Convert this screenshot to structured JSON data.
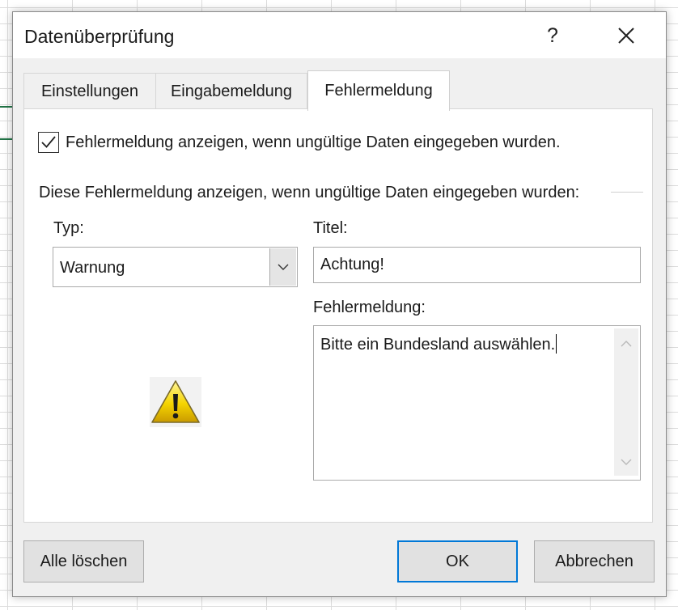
{
  "dialog": {
    "title": "Datenüberprüfung",
    "help_label": "?"
  },
  "tabs": [
    {
      "label": "Einstellungen",
      "active": false
    },
    {
      "label": "Eingabemeldung",
      "active": false
    },
    {
      "label": "Fehlermeldung",
      "active": true
    }
  ],
  "checkbox": {
    "label": "Fehlermeldung anzeigen, wenn ungültige Daten eingegeben wurden.",
    "checked": true
  },
  "description": "Diese Fehlermeldung anzeigen, wenn ungültige Daten eingegeben wurden:",
  "type_field": {
    "label": "Typ:",
    "value": "Warnung",
    "icon": "warning-icon"
  },
  "title_field": {
    "label": "Titel:",
    "value": "Achtung!"
  },
  "message_field": {
    "label": "Fehlermeldung:",
    "value": "Bitte ein Bundesland auswählen."
  },
  "buttons": {
    "clear": "Alle löschen",
    "ok": "OK",
    "cancel": "Abbrechen"
  },
  "colors": {
    "focus_accent": "#0078d7",
    "warning_yellow": "#f5d400",
    "excel_green": "#217346"
  }
}
